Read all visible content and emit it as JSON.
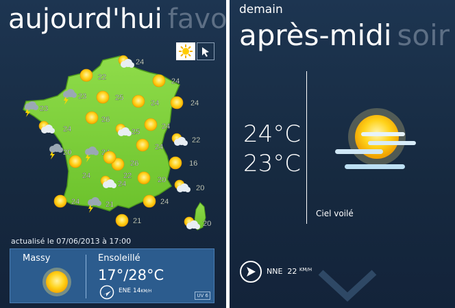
{
  "left_panel": {
    "title_active": "aujourd'hui",
    "title_next": "favo",
    "legend": {
      "sun_icon": "sun-icon",
      "cursor_icon": "cursor-icon"
    },
    "map": {
      "region": "France",
      "stations": [
        {
          "temp": "24",
          "icon": "cloudy-sun-icon"
        },
        {
          "temp": "22",
          "icon": "sun-icon"
        },
        {
          "temp": "24",
          "icon": "sun-icon"
        },
        {
          "temp": "23",
          "icon": "storm-icon"
        },
        {
          "temp": "25",
          "icon": "sun-icon"
        },
        {
          "temp": "24",
          "icon": "sun-icon"
        },
        {
          "temp": "24",
          "icon": "sun-icon"
        },
        {
          "temp": "23",
          "icon": "storm-icon"
        },
        {
          "temp": "26",
          "icon": "sun-icon"
        },
        {
          "temp": "25",
          "icon": "cloudy-sun-icon"
        },
        {
          "temp": "24",
          "icon": "cloudy-sun-icon"
        },
        {
          "temp": "24",
          "icon": "sun-icon"
        },
        {
          "temp": "22",
          "icon": "cloudy-sun-icon"
        },
        {
          "temp": "20",
          "icon": "storm-icon"
        },
        {
          "temp": "24",
          "icon": "storm-icon"
        },
        {
          "temp": "24",
          "icon": "sun-icon"
        },
        {
          "temp": "26",
          "icon": "sun-icon"
        },
        {
          "temp": "16",
          "icon": "sun-icon"
        },
        {
          "temp": "24",
          "icon": "sun-icon"
        },
        {
          "temp": "24",
          "icon": "cloudy-sun-icon"
        },
        {
          "temp": "20",
          "icon": "sun-icon"
        },
        {
          "temp": "24",
          "icon": "sun-icon"
        },
        {
          "temp": "21",
          "icon": "storm-icon"
        },
        {
          "temp": "24",
          "icon": "sun-icon"
        },
        {
          "temp": "20",
          "icon": "cloudy-sun-icon"
        },
        {
          "temp": "21",
          "icon": "sun-icon"
        },
        {
          "temp": "20",
          "icon": "cloudy-sun-icon"
        },
        {
          "temp": "22",
          "icon": "sun-icon"
        }
      ]
    },
    "updated": "actualisé le 07/06/2013 à 17:00",
    "current": {
      "city": "Massy",
      "condition": "Ensoleillé",
      "temps": "17°/28°C",
      "wind_dir": "ENE",
      "wind_speed": "14",
      "wind_unit": "KM/H",
      "uv": "UV 6",
      "icon": "sun-icon"
    }
  },
  "right_panel": {
    "subtitle": "demain",
    "title_active": "après-midi",
    "title_next": "soir",
    "temp1": "24°C",
    "temp2": "23°C",
    "description": "Ciel voilé",
    "wind_dir": "NNE",
    "wind_speed": "22",
    "wind_unit": "KM/H",
    "icon": "hazy-sun-icon"
  }
}
